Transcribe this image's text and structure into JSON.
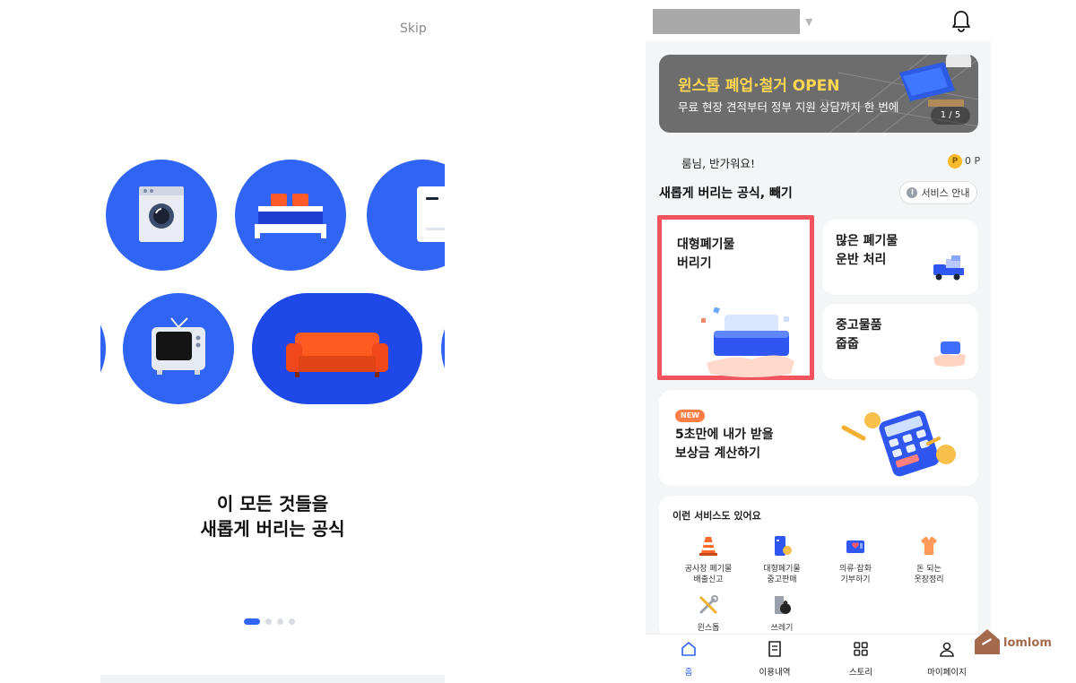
{
  "onboarding": {
    "skip_label": "Skip",
    "title_line1": "이 모든 것들을",
    "title_line2": "새롭게 버리는 공식",
    "page_total": 4,
    "page_current": 1
  },
  "app": {
    "banner": {
      "title": "윈스톱 폐업·철거 OPEN",
      "subtitle": "무료 현장 견적부터 정부 지원 상담까지 한 번에",
      "page_indicator": "1 / 5"
    },
    "greeting": "룸님, 반가워요!",
    "points": {
      "coin_label": "P",
      "value": "0 P"
    },
    "section_title": "새롭게 버리는 공식, 빼기",
    "service_guide_label": "서비스 안내",
    "cards": {
      "bulky": {
        "line1": "대형폐기물",
        "line2": "버리기"
      },
      "carry": {
        "line1": "많은 폐기물",
        "line2": "운반 처리"
      },
      "used": {
        "line1": "중고물품",
        "line2": "줍줍"
      },
      "calc": {
        "badge": "NEW",
        "line1": "5초만에 내가 받을",
        "line2": "보상금 계산하기"
      }
    },
    "services": {
      "title": "이런 서비스도 있어요",
      "items": [
        {
          "line1": "공사장 폐기물",
          "line2": "배출신고",
          "icon": "traffic-cone-icon"
        },
        {
          "line1": "대형폐기물",
          "line2": "중고판매",
          "icon": "fridge-coin-icon"
        },
        {
          "line1": "의류·잡화",
          "line2": "기부하기",
          "icon": "donation-box-icon"
        },
        {
          "line1": "돈 되는",
          "line2": "옷장정리",
          "icon": "clothes-icon"
        },
        {
          "line1": "윈스톱",
          "line2": "",
          "icon": "tools-icon"
        },
        {
          "line1": "쓰레기",
          "line2": "",
          "icon": "trash-bag-icon"
        }
      ]
    },
    "tabs": [
      {
        "label": "홈",
        "icon": "home-icon"
      },
      {
        "label": "이용내역",
        "icon": "receipt-icon"
      },
      {
        "label": "스토리",
        "icon": "grid-icon"
      },
      {
        "label": "마이페이지",
        "icon": "person-icon"
      }
    ],
    "colors": {
      "primary": "#2f64f5",
      "banner_title": "#ffd651",
      "highlight_border": "#f2545e",
      "new_badge": "#ff7e47"
    }
  },
  "watermark": {
    "text": "lomlom"
  }
}
